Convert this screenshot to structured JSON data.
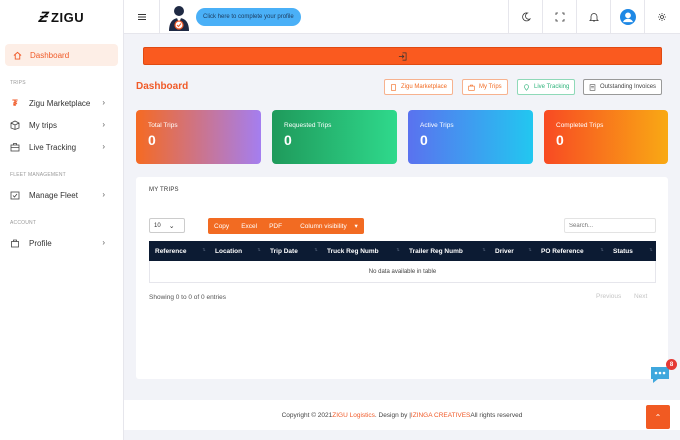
{
  "brand": {
    "mark": "Ƶ",
    "name": "ZIGU"
  },
  "sidebar": {
    "active": {
      "label": "Dashboard",
      "icon": "home-icon"
    },
    "sections": {
      "trips": "TRIPS",
      "fleet": "FLEET MANAGEMENT",
      "account": "ACCOUNT"
    },
    "items": [
      {
        "label": "Zigu Marketplace",
        "icon": "zigu-icon"
      },
      {
        "label": "My trips",
        "icon": "box-icon"
      },
      {
        "label": "Live Tracking",
        "icon": "briefcase-icon"
      },
      {
        "label": "Manage Fleet",
        "icon": "fleet-icon"
      },
      {
        "label": "Profile",
        "icon": "bag-icon"
      }
    ]
  },
  "topbar": {
    "complete_profile": "Click here to complete your profile",
    "icons": [
      "menu-icon",
      "moon-icon",
      "fullscreen-icon",
      "bell-icon",
      "user-avatar-icon",
      "gear-icon"
    ]
  },
  "page": {
    "title": "Dashboard",
    "quick_buttons": [
      {
        "label": "Zigu Marketplace",
        "color": "#f26b22"
      },
      {
        "label": "My Trips",
        "color": "#f26b22"
      },
      {
        "label": "Live Tracking",
        "color": "#2db37a"
      },
      {
        "label": "Outstanding Invoices",
        "color": "#555555"
      }
    ]
  },
  "cards": [
    {
      "label": "Total Trips",
      "value": "0",
      "from": "#f56a22",
      "to": "#a47ef0"
    },
    {
      "label": "Requested Trips",
      "value": "0",
      "from": "#1f9a5b",
      "to": "#2fd98c"
    },
    {
      "label": "Active Trips",
      "value": "0",
      "from": "#5a72ef",
      "to": "#22c7f0"
    },
    {
      "label": "Completed Trips",
      "value": "0",
      "from": "#f84a23",
      "to": "#f9a914"
    }
  ],
  "trips_panel": {
    "title": "MY TRIPS",
    "page_length": "10",
    "buttons": [
      "Copy",
      "Excel",
      "PDF",
      "Column visibility"
    ],
    "search_placeholder": "Search...",
    "columns": [
      "Reference",
      "Location",
      "Trip Date",
      "Truck Reg Numb",
      "Trailer Reg Numb",
      "Driver",
      "PO Reference",
      "Status"
    ],
    "empty_text": "No data available in table",
    "info": "Showing 0 to 0 of 0 entries",
    "prev": "Previous",
    "next": "Next"
  },
  "footer": {
    "prefix": "Copyright © 2021 ",
    "company": "ZIGU Logistics",
    "middle": ". Design by | ",
    "designer": "IZINGA CREATIVES",
    "suffix": " All rights reserved"
  },
  "chat": {
    "badge": "8"
  }
}
